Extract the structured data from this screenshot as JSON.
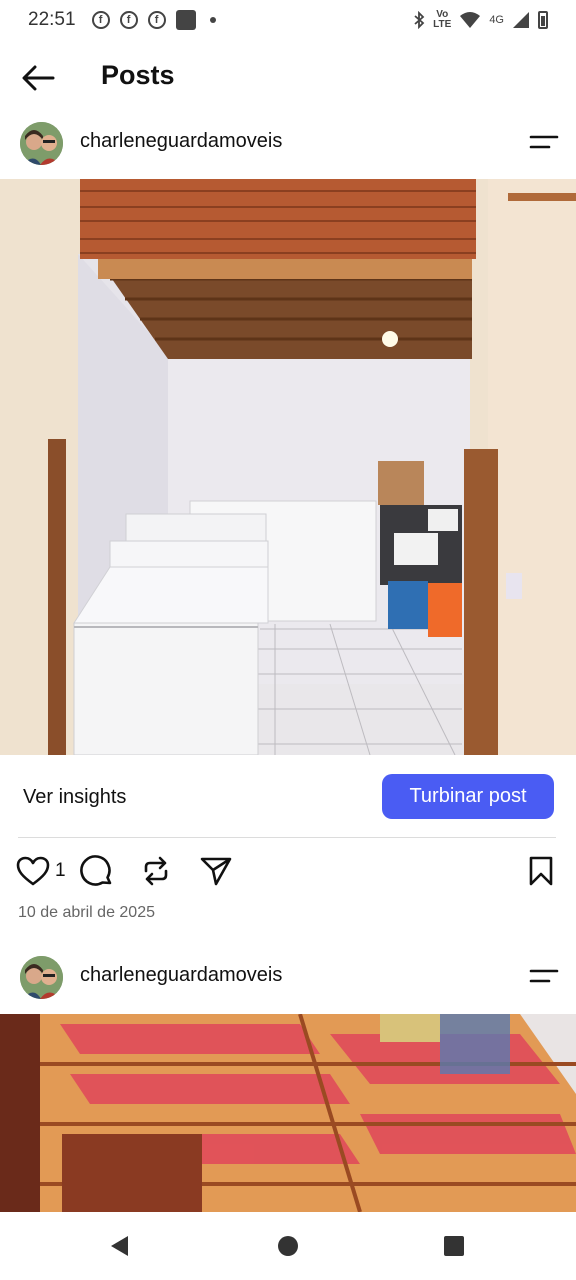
{
  "status_bar": {
    "time": "22:51",
    "network": "4G",
    "volte_line1": "Vo",
    "volte_line2": "LTE",
    "icons": [
      "facebook-icon",
      "facebook-icon",
      "facebook-icon",
      "photo-icon",
      "dot-icon",
      "bluetooth-icon",
      "volte-icon",
      "wifi-icon",
      "signal-icon",
      "battery-icon"
    ]
  },
  "header": {
    "title": "Posts",
    "back_icon": "arrow-left-icon"
  },
  "posts": [
    {
      "username": "charleneguardamoveis",
      "insights_label": "Ver insights",
      "boost_label": "Turbinar post",
      "likes": "1",
      "date": "10 de abril de 2025"
    },
    {
      "username": "charleneguardamoveis"
    }
  ],
  "colors": {
    "accent": "#4a5cf3",
    "text": "#111111",
    "muted": "#666666"
  },
  "nav_bar": {
    "icons": [
      "back-triangle-icon",
      "home-circle-icon",
      "recents-square-icon"
    ]
  }
}
